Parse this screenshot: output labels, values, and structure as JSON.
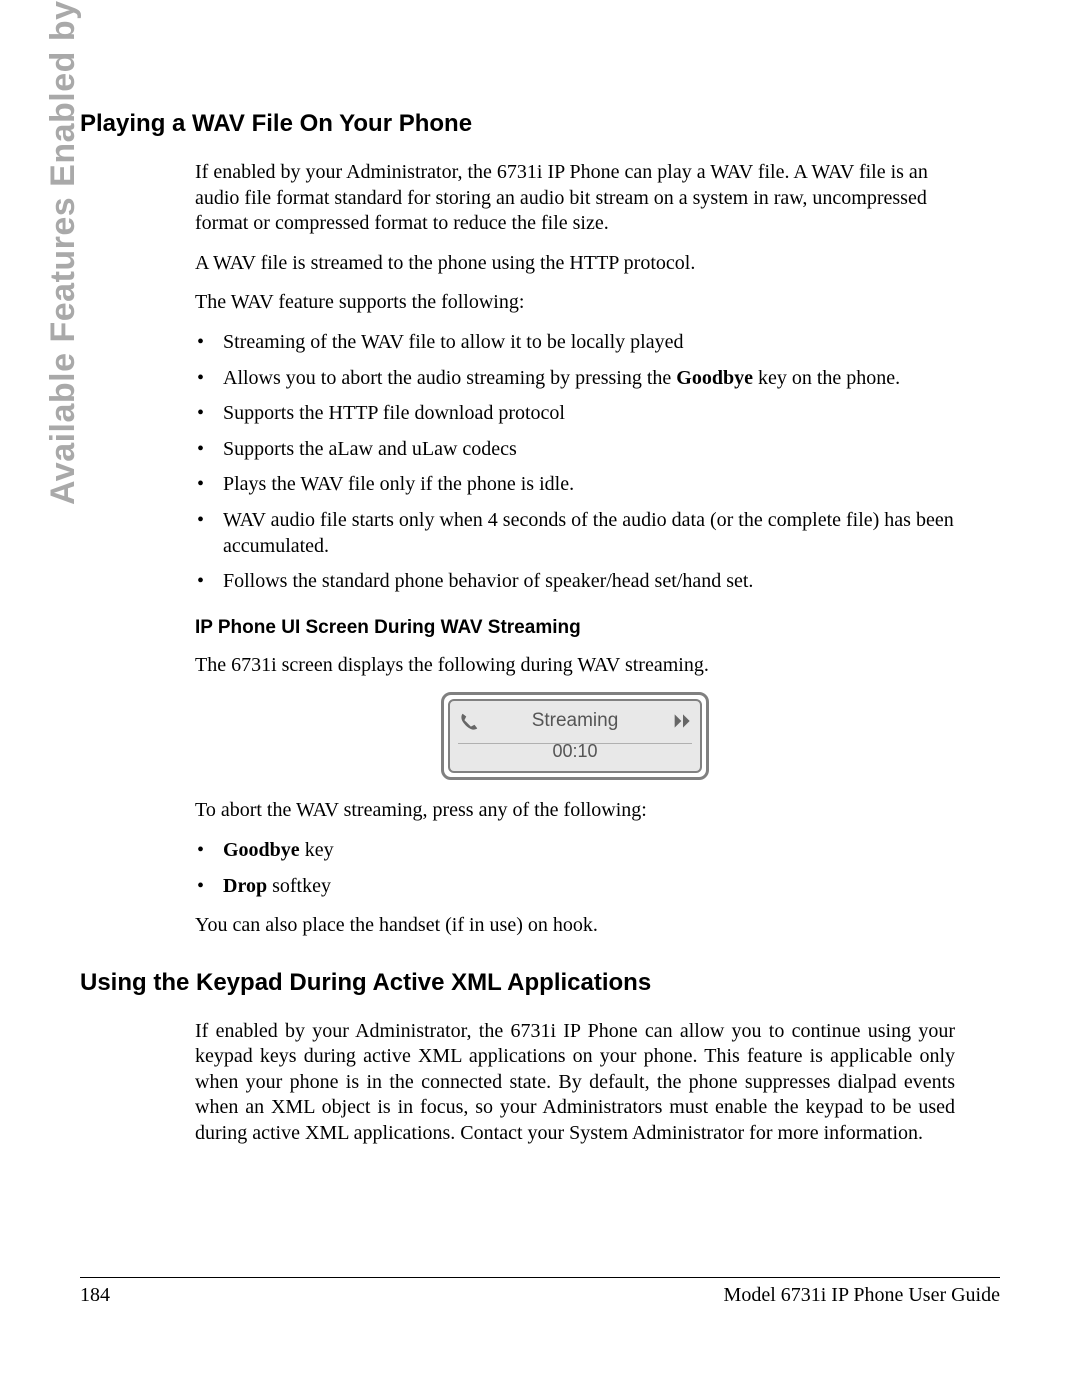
{
  "sideLabel": "Available Features Enabled by Administrators",
  "section1": {
    "heading": "Playing a WAV File On Your Phone",
    "para1": "If enabled by your Administrator, the 6731i IP Phone can play a WAV file. A WAV file is an audio file format standard for storing an audio bit stream on a system in raw, uncompressed format or compressed format to reduce the file size.",
    "para2": "A WAV file is streamed to the phone using the HTTP protocol.",
    "para3": "The WAV feature supports the following:",
    "bullets": [
      "Streaming of the WAV file to allow it to be locally played",
      "Allows you to abort the audio streaming by pressing the <b>Goodbye</b> key on the phone.",
      "Supports the HTTP file download protocol",
      "Supports the aLaw and uLaw codecs",
      "Plays the WAV file only if the phone is idle.",
      "WAV audio file starts only when 4 seconds of the audio data (or the complete file) has been accumulated.",
      "Follows the standard phone behavior of speaker/head set/hand set."
    ],
    "subheading": "IP Phone UI Screen During WAV Streaming",
    "para4": "The 6731i screen displays the following during WAV streaming.",
    "phone": {
      "line1": "Streaming",
      "line2": "00:10"
    },
    "para5": "To abort the WAV streaming, press any of the following:",
    "bullets2": [
      "<b>Goodbye</b> key",
      "<b>Drop</b> softkey"
    ],
    "para6": "You can also place the handset (if in use) on hook."
  },
  "section2": {
    "heading": "Using the Keypad During Active XML Applications",
    "para1": "If enabled by your Administrator, the 6731i IP Phone can allow you to continue using your keypad keys during active XML applications on your phone. This feature is applicable only when your phone is in the connected state. By default, the phone suppresses dialpad events when an XML object is in focus, so your Administrators must enable the keypad to be used during active XML applications. Contact your System Administrator for more information."
  },
  "footer": {
    "pageNumber": "184",
    "docTitle": "Model 6731i IP Phone User Guide"
  }
}
